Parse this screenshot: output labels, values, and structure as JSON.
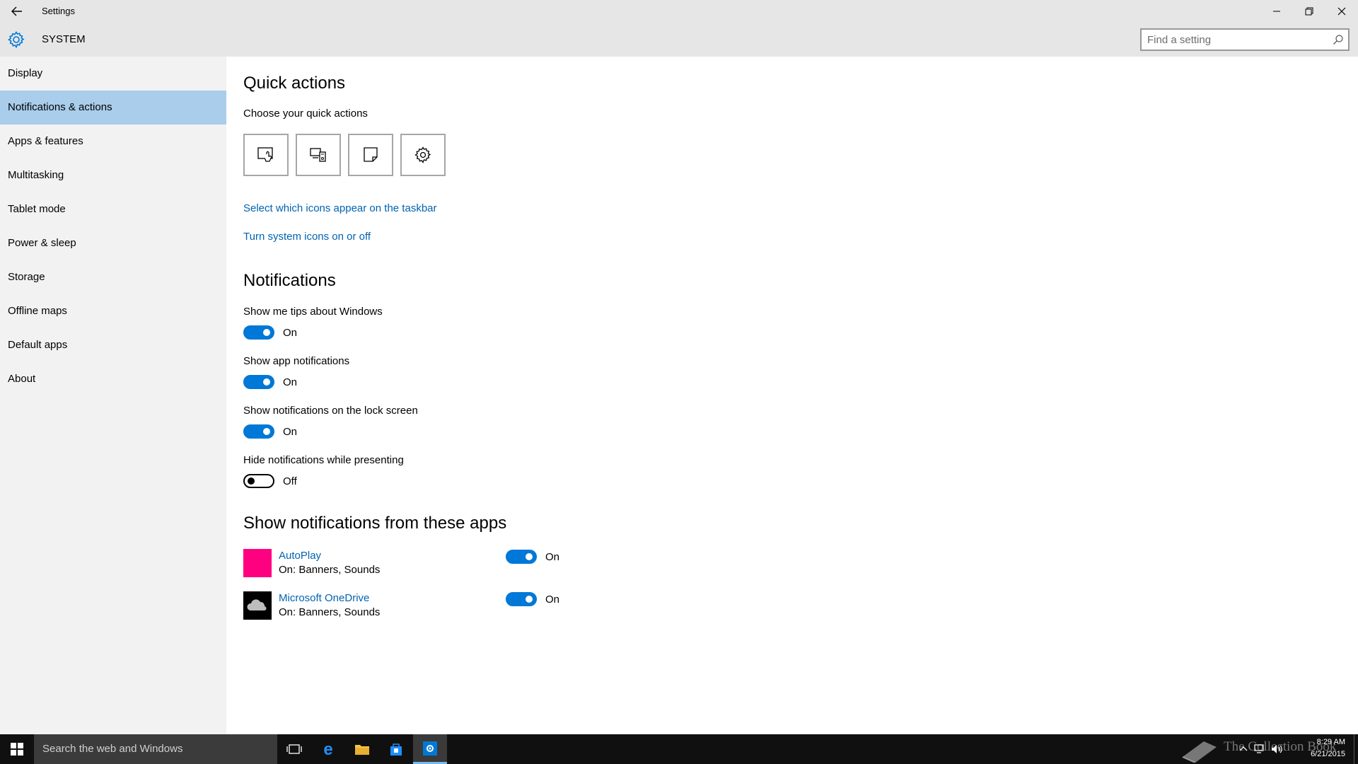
{
  "window": {
    "title": "Settings",
    "section_title": "SYSTEM"
  },
  "search": {
    "placeholder": "Find a setting"
  },
  "sidebar": {
    "items": [
      {
        "label": "Display"
      },
      {
        "label": "Notifications & actions",
        "active": true
      },
      {
        "label": "Apps & features"
      },
      {
        "label": "Multitasking"
      },
      {
        "label": "Tablet mode"
      },
      {
        "label": "Power & sleep"
      },
      {
        "label": "Storage"
      },
      {
        "label": "Offline maps"
      },
      {
        "label": "Default apps"
      },
      {
        "label": "About"
      }
    ]
  },
  "quick_actions": {
    "heading": "Quick actions",
    "subheading": "Choose your quick actions",
    "tiles": [
      {
        "icon": "tablet-mode-icon"
      },
      {
        "icon": "connect-icon"
      },
      {
        "icon": "note-icon"
      },
      {
        "icon": "settings-gear-icon"
      }
    ],
    "link_taskbar_icons": "Select which icons appear on the taskbar",
    "link_system_icons": "Turn system icons on or off"
  },
  "notifications": {
    "heading": "Notifications",
    "settings": [
      {
        "label": "Show me tips about Windows",
        "state": "On",
        "on": true
      },
      {
        "label": "Show app notifications",
        "state": "On",
        "on": true
      },
      {
        "label": "Show notifications on the lock screen",
        "state": "On",
        "on": true
      },
      {
        "label": "Hide notifications while presenting",
        "state": "Off",
        "on": false
      }
    ]
  },
  "apps_section": {
    "heading": "Show notifications from these apps",
    "apps": [
      {
        "name": "AutoPlay",
        "detail": "On: Banners, Sounds",
        "state": "On",
        "on": true,
        "icon_color": "#ff0080"
      },
      {
        "name": "Microsoft OneDrive",
        "detail": "On: Banners, Sounds",
        "state": "On",
        "on": true,
        "icon_color": "#000000"
      }
    ]
  },
  "taskbar": {
    "search_text": "Search the web and Windows",
    "clock_time": "8:29 AM",
    "clock_date": "6/21/2015",
    "watermark": "The Collection Book"
  },
  "colors": {
    "accent": "#0078d7",
    "link": "#0063b1",
    "selected_nav": "#a9cdeb"
  }
}
